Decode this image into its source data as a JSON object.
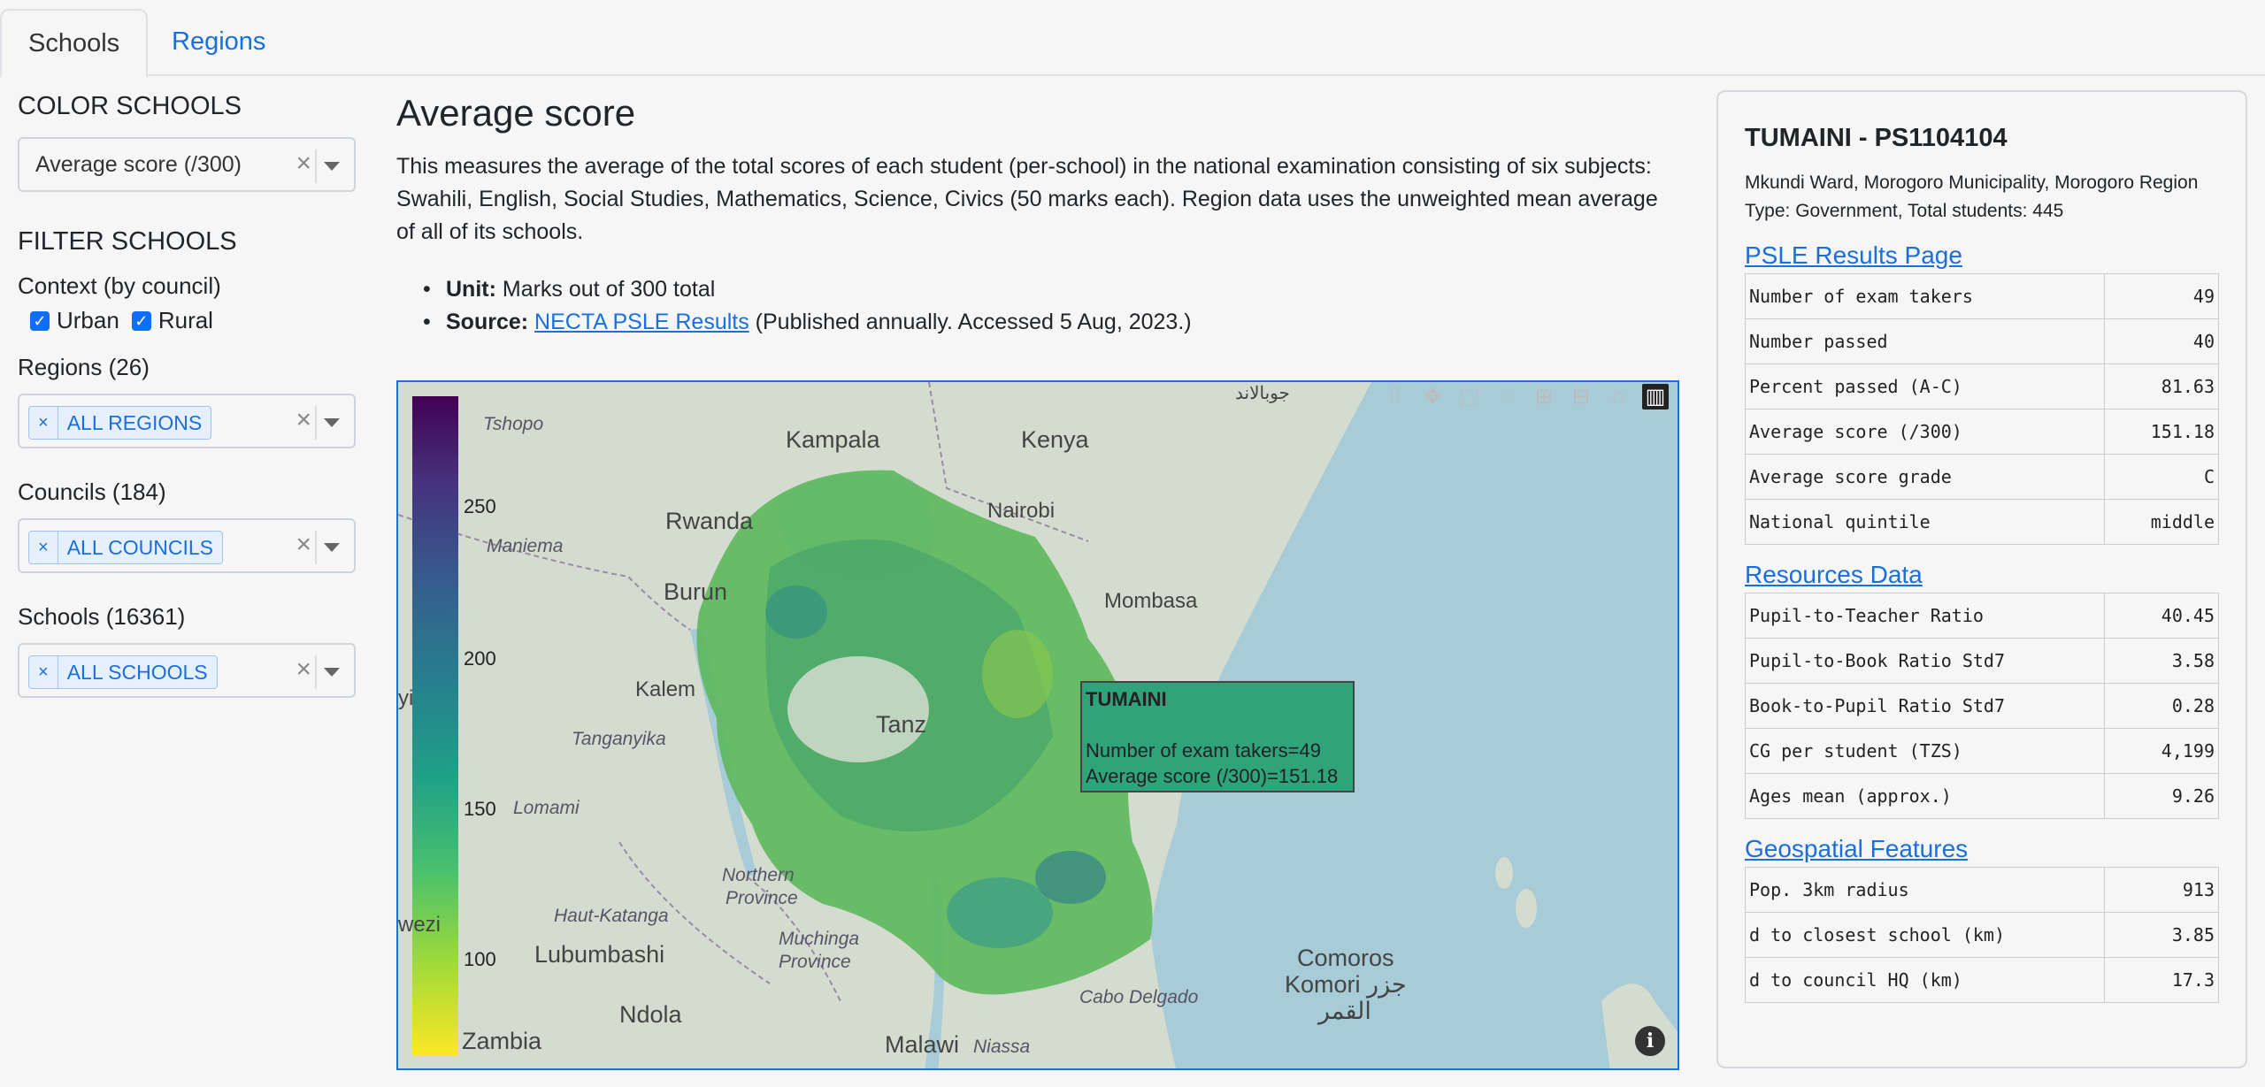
{
  "tabs": {
    "schools": "Schools",
    "regions": "Regions"
  },
  "sidebar": {
    "color_title": "COLOR SCHOOLS",
    "color_select": "Average score (/300)",
    "filter_title": "FILTER SCHOOLS",
    "context_label": "Context (by council)",
    "urban_label": "Urban",
    "rural_label": "Rural",
    "regions_label": "Regions (26)",
    "regions_chip": "ALL REGIONS",
    "councils_label": "Councils (184)",
    "councils_chip": "ALL COUNCILS",
    "schools_label": "Schools (16361)",
    "schools_chip": "ALL SCHOOLS"
  },
  "main": {
    "title": "Average score",
    "description": "This measures the average of the total scores of each student (per-school) in the national examination consisting of six subjects: Swahili, English, Social Studies, Mathematics, Science, Civics (50 marks each). Region data uses the unweighted mean average of all of its schools.",
    "unit_label": "Unit:",
    "unit_value": " Marks out of 300 total",
    "source_label": "Source:",
    "source_link": "NECTA PSLE Results",
    "source_note": " (Published annually. Accessed 5 Aug, 2023.)"
  },
  "map": {
    "colorbar_ticks": [
      "250",
      "200",
      "150",
      "100"
    ],
    "labels": {
      "tshopo": "Tshopo",
      "kampala": "Kampala",
      "kenya": "Kenya",
      "rwanda": "Rwanda",
      "nairobi": "Nairobi",
      "maniema": "Maniema",
      "burundi": "Burun",
      "mombasa": "Mombasa",
      "kalemie": "Kalem",
      "yi": "yi",
      "tanganyika": "Tanganyika",
      "tanz": "Tanz",
      "lomami": "Lomami",
      "northern": "Northern",
      "province": "Province",
      "wezi": "wezi",
      "haut_katanga": "Haut-Katanga",
      "muchinga": "Muchinga",
      "muchinga_prov": "Province",
      "lubumbashi": "Lubumbashi",
      "comoros": "Comoros",
      "komori": "Komori جزر",
      "alqamar": "القمر",
      "cabo_delgado": "Cabo Delgado",
      "ndola": "Ndola",
      "zambia": "Zambia",
      "malawi": "Malawi",
      "niassa": "Niassa",
      "top_arabic": "جوبالاند"
    },
    "tooltip": {
      "name": "TUMAINI",
      "line1": "Number of exam takers=49",
      "line2": "Average score (/300)=151.18"
    },
    "info_icon": "i"
  },
  "panel": {
    "title": "TUMAINI - PS1104104",
    "address": "Mkundi Ward, Morogoro Municipality, Morogoro Region",
    "type_line": "Type: Government, Total students: 445",
    "psle_link": "PSLE Results Page",
    "psle_rows": [
      {
        "k": "Number of exam takers",
        "v": "49"
      },
      {
        "k": "Number passed",
        "v": "40"
      },
      {
        "k": "Percent passed (A-C)",
        "v": "81.63"
      },
      {
        "k": "Average score (/300)",
        "v": "151.18"
      },
      {
        "k": "Average score grade",
        "v": "C"
      },
      {
        "k": "National quintile",
        "v": "middle"
      }
    ],
    "resources_link": "Resources Data",
    "resources_rows": [
      {
        "k": "Pupil-to-Teacher Ratio",
        "v": "40.45"
      },
      {
        "k": "Pupil-to-Book Ratio Std7",
        "v": "3.58"
      },
      {
        "k": "Book-to-Pupil Ratio Std7",
        "v": "0.28"
      },
      {
        "k": "CG per student (TZS)",
        "v": "4,199"
      },
      {
        "k": "Ages mean (approx.)",
        "v": "9.26"
      }
    ],
    "geo_link": "Geospatial Features",
    "geo_rows": [
      {
        "k": "Pop. 3km radius",
        "v": "913"
      },
      {
        "k": "d to closest school (km)",
        "v": "3.85"
      },
      {
        "k": "d to council HQ (km)",
        "v": "17.3"
      }
    ]
  }
}
